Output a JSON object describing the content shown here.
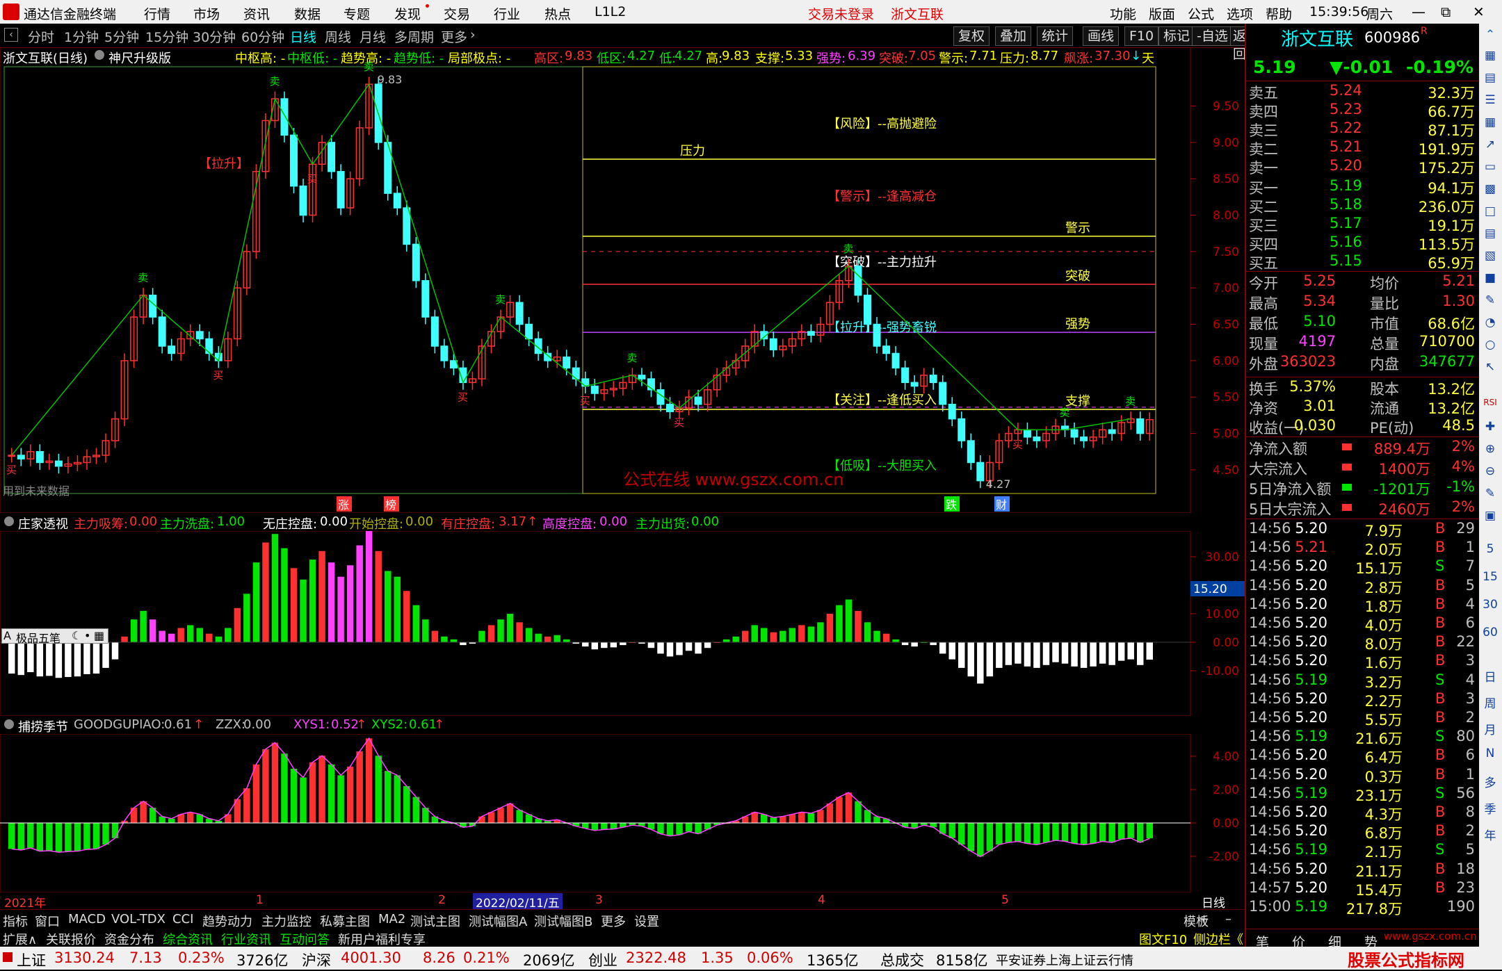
{
  "menu": {
    "app_title": "通达信金融终端",
    "items": [
      "行情",
      "市场",
      "资讯",
      "数据",
      "专题",
      "发现",
      "交易",
      "行业",
      "热点",
      "L1L2"
    ],
    "login": "交易未登录",
    "stock_name_top": "浙文互联",
    "right": [
      "功能",
      "版面",
      "公式",
      "选项",
      "帮助"
    ],
    "time": "15:39:56",
    "weekday": "周六"
  },
  "period": {
    "items": [
      "分时",
      "1分钟",
      "5分钟",
      "15分钟",
      "30分钟",
      "60分钟",
      "日线",
      "周线",
      "月线",
      "多周期",
      "更多"
    ],
    "active": "日线",
    "tools": [
      "复权",
      "叠加",
      "统计",
      "画线",
      "F10",
      "标记",
      "-自选",
      "返回"
    ]
  },
  "main_header": {
    "title": "浙文互联(日线)",
    "formula": "神尺升级版",
    "f1": "中枢高: -",
    "f2": "中枢低: -",
    "f3": "趋势高: -",
    "f4": "趋势低: -",
    "f5": "局部极点: -",
    "hi_zone_label": "高区:",
    "hi_zone": "9.83",
    "lo_zone_label": "低区:",
    "lo_zone": "4.27",
    "low_label": "低:",
    "low": "4.27",
    "high_label": "高:",
    "high": "9.83",
    "support_label": "支撑:",
    "support": "5.33",
    "strong_label": "强势:",
    "strong": "6.39",
    "break_label": "突破:",
    "break": "7.05",
    "warn_label": "警示:",
    "warn": "7.71",
    "press_label": "压力:",
    "press": "8.77",
    "surge_label": "飙涨:",
    "surge": "37.30",
    "tail": "天"
  },
  "chart_data": {
    "type": "candlestick",
    "y_ticks": [
      "9.50",
      "9.00",
      "8.50",
      "8.00",
      "7.50",
      "7.00",
      "6.50",
      "6.00",
      "5.50",
      "5.00",
      "4.50"
    ],
    "ylim": [
      4.27,
      9.83
    ],
    "high_mark": "9.83",
    "low_mark": "4.27",
    "levels": [
      {
        "name": "压力",
        "value": 8.77,
        "color": "#ffff40"
      },
      {
        "name": "警示",
        "value": 7.71,
        "color": "#ffff40"
      },
      {
        "name": "突破",
        "value": 7.05,
        "color": "#ff3030"
      },
      {
        "name": "强势",
        "value": 6.39,
        "color": "#c040ff"
      },
      {
        "name": "支撑",
        "value": 5.33,
        "color": "#ffff40"
      }
    ],
    "annotations": [
      "【风险】--高抛避险",
      "【警示】--逢高减仓",
      "【突破】--主力拉升",
      "【拉升】--强势畜锐",
      "【关注】--逢低买入",
      "【低吸】--大胆买入",
      "【拉升】"
    ],
    "buy_label": "买",
    "sell_label": "卖",
    "watermark": "公式在线 www.gszx.com.cn",
    "future_note": "用到未来数据",
    "bottom_marks": [
      "涨",
      "榜",
      "跌",
      "财"
    ],
    "closes": [
      4.7,
      4.65,
      4.75,
      4.6,
      4.62,
      4.55,
      4.58,
      4.6,
      4.68,
      4.7,
      4.9,
      5.2,
      6.0,
      6.6,
      6.9,
      6.6,
      6.2,
      6.1,
      6.3,
      6.4,
      6.3,
      6.1,
      6.0,
      6.3,
      7.0,
      7.5,
      8.6,
      9.3,
      9.6,
      9.1,
      8.4,
      8.0,
      8.7,
      9.0,
      8.6,
      8.1,
      8.5,
      9.2,
      9.8,
      9.0,
      8.3,
      8.1,
      7.6,
      7.1,
      6.6,
      6.2,
      6.0,
      5.9,
      5.7,
      5.75,
      6.2,
      6.4,
      6.6,
      6.8,
      6.5,
      6.3,
      6.1,
      6.0,
      6.05,
      5.9,
      5.75,
      5.65,
      5.55,
      5.6,
      5.62,
      5.7,
      5.8,
      5.75,
      5.6,
      5.4,
      5.3,
      5.35,
      5.5,
      5.4,
      5.6,
      5.8,
      5.9,
      6.0,
      6.2,
      6.4,
      6.3,
      6.15,
      6.2,
      6.3,
      6.4,
      6.35,
      6.5,
      6.8,
      7.1,
      7.3,
      6.9,
      6.5,
      6.2,
      6.1,
      5.9,
      5.7,
      5.65,
      5.8,
      5.7,
      5.4,
      5.2,
      4.9,
      4.6,
      4.35,
      4.6,
      4.9,
      5.0,
      5.05,
      4.95,
      4.9,
      5.0,
      5.1,
      5.05,
      4.95,
      4.9,
      4.95,
      5.05,
      5.0,
      5.15,
      5.2,
      5.0,
      5.19
    ]
  },
  "zhuangjia": {
    "title": "庄家透视",
    "items": [
      {
        "label": "主力吸筹:",
        "value": "0.00",
        "color": "#ff3030"
      },
      {
        "label": "主力洗盘:",
        "value": "1.00",
        "color": "#00e600"
      },
      {
        "label": "无庄控盘:",
        "value": "0.00",
        "color": "#ffffff"
      },
      {
        "label": "开始控盘:",
        "value": "0.00",
        "color": "#b0b000"
      },
      {
        "label": "有庄控盘:",
        "value": "3.17",
        "color": "#ff3030"
      },
      {
        "label": "高度控盘:",
        "value": "0.00",
        "color": "#ff40ff"
      },
      {
        "label": "主力出货:",
        "value": "0.00",
        "color": "#00e600"
      }
    ],
    "y_ticks": [
      "30.00",
      "20.00",
      "10.00",
      "0.00",
      "-10.00"
    ],
    "current": "15.20",
    "brush_label": "极品五笔"
  },
  "buzhuo": {
    "title": "捕捞季节",
    "items": [
      {
        "label": "GOODGUPIAO:",
        "value": "0.61",
        "color": "#c0c0c0"
      },
      {
        "label": "ZZX:",
        "value": "0.00",
        "color": "#c0c0c0"
      },
      {
        "label": "XYS1:",
        "value": "0.52",
        "color": "#ff40ff"
      },
      {
        "label": "XYS2:",
        "value": "0.61",
        "color": "#00e600"
      }
    ],
    "y_ticks": [
      "4.00",
      "2.00",
      "0.00",
      "-2.00"
    ]
  },
  "time_axis": {
    "year": "2021年",
    "m1": "1",
    "m2": "2",
    "date": "2022/02/11/五",
    "m3": "3",
    "m4": "4",
    "m5": "5",
    "period": "日线"
  },
  "tabs1": [
    "指标",
    "窗口",
    "MACD",
    "VOL-TDX",
    "CCI",
    "趋势动力",
    "主力监控",
    "私募主图",
    "MA2",
    "测试主图",
    "测试幅图A",
    "测试幅图B",
    "更多",
    "设置"
  ],
  "tabs1_right": "模板",
  "tabs2": [
    "扩展∧",
    "关联报价",
    "资金分布",
    "综合资讯",
    "行业资讯",
    "互动问答",
    "新用户福利专享"
  ],
  "tabs2_right": [
    "图文F10",
    "侧边栏《"
  ],
  "quote": {
    "name": "浙文互联",
    "code": "600986",
    "flag": "R",
    "price": "5.19",
    "change": "▼-0.01",
    "pct": "-0.19%",
    "asks": [
      {
        "label": "卖五",
        "price": "5.24",
        "vol": "32.3万"
      },
      {
        "label": "卖四",
        "price": "5.23",
        "vol": "66.7万"
      },
      {
        "label": "卖三",
        "price": "5.22",
        "vol": "87.1万"
      },
      {
        "label": "卖二",
        "price": "5.21",
        "vol": "191.9万"
      },
      {
        "label": "卖一",
        "price": "5.20",
        "vol": "175.2万"
      }
    ],
    "bids": [
      {
        "label": "买一",
        "price": "5.19",
        "vol": "94.1万"
      },
      {
        "label": "买二",
        "price": "5.18",
        "vol": "236.0万"
      },
      {
        "label": "买三",
        "price": "5.17",
        "vol": "19.1万"
      },
      {
        "label": "买四",
        "price": "5.16",
        "vol": "113.5万"
      },
      {
        "label": "买五",
        "price": "5.15",
        "vol": "65.9万"
      }
    ],
    "stats": [
      [
        "今开",
        "5.25",
        "均价",
        "5.21"
      ],
      [
        "最高",
        "5.34",
        "量比",
        "1.30"
      ],
      [
        "最低",
        "5.10",
        "市值",
        "68.6亿"
      ],
      [
        "现量",
        "4197",
        "总量",
        "710700"
      ],
      [
        "外盘",
        "363023",
        "内盘",
        "347677"
      ]
    ],
    "stats2": [
      [
        "换手",
        "5.37%",
        "股本",
        "13.2亿"
      ],
      [
        "净资",
        "3.01",
        "流通",
        "13.2亿"
      ],
      [
        "收益(一)",
        "0.030",
        "PE(动)",
        "48.5"
      ]
    ],
    "flows": [
      {
        "label": "净流入额",
        "value": "889.4万",
        "pct": "2%",
        "dir": "up"
      },
      {
        "label": "大宗流入",
        "value": "1400万",
        "pct": "4%",
        "dir": "up"
      },
      {
        "label": "5日净流入额",
        "value": "-1201万",
        "pct": "-1%",
        "dir": "down"
      },
      {
        "label": "5日大宗流入",
        "value": "2460万",
        "pct": "2%",
        "dir": "up"
      }
    ],
    "ticks": [
      [
        "14:56",
        "5.20",
        "7.9万",
        "B",
        "29"
      ],
      [
        "14:56",
        "5.21",
        "2.0万",
        "B",
        "1"
      ],
      [
        "14:56",
        "5.20",
        "15.1万",
        "S",
        "7"
      ],
      [
        "14:56",
        "5.20",
        "2.8万",
        "B",
        "5"
      ],
      [
        "14:56",
        "5.20",
        "1.8万",
        "B",
        "4"
      ],
      [
        "14:56",
        "5.20",
        "4.0万",
        "B",
        "6"
      ],
      [
        "14:56",
        "5.20",
        "8.0万",
        "B",
        "22"
      ],
      [
        "14:56",
        "5.20",
        "1.6万",
        "B",
        "3"
      ],
      [
        "14:56",
        "5.19",
        "3.2万",
        "S",
        "4"
      ],
      [
        "14:56",
        "5.20",
        "2.2万",
        "B",
        "3"
      ],
      [
        "14:56",
        "5.20",
        "5.5万",
        "B",
        "2"
      ],
      [
        "14:56",
        "5.19",
        "21.6万",
        "S",
        "80"
      ],
      [
        "14:56",
        "5.20",
        "6.4万",
        "B",
        "6"
      ],
      [
        "14:56",
        "5.20",
        "0.3万",
        "B",
        "1"
      ],
      [
        "14:56",
        "5.19",
        "23.1万",
        "S",
        "56"
      ],
      [
        "14:56",
        "5.20",
        "4.3万",
        "B",
        "8"
      ],
      [
        "14:56",
        "5.20",
        "6.8万",
        "B",
        "2"
      ],
      [
        "14:56",
        "5.19",
        "2.1万",
        "S",
        "5"
      ],
      [
        "14:56",
        "5.20",
        "21.1万",
        "B",
        "18"
      ],
      [
        "14:57",
        "5.20",
        "15.4万",
        "B",
        "23"
      ],
      [
        "15:00",
        "5.19",
        "217.8万",
        "",
        "190"
      ]
    ],
    "bottom_tabs": [
      "笔",
      "价",
      "细",
      "势"
    ]
  },
  "right_tools": [
    "日",
    "周",
    "月",
    "N",
    "多",
    "季",
    "年",
    "5",
    "15",
    "30",
    "60",
    "RSI"
  ],
  "status": {
    "idx1_name": "上证",
    "idx1_val": "3130.24",
    "idx1_chg": "7.13",
    "idx1_pct": "0.23%",
    "idx1_amt": "3726亿",
    "idx2_name": "沪深",
    "idx2_val": "4001.30",
    "idx2_chg": "8.26",
    "idx2_pct": "0.21%",
    "idx2_amt": "2069亿",
    "idx3_name": "创业",
    "idx3_val": "2322.48",
    "idx3_chg": "1.35",
    "idx3_pct": "0.06%",
    "idx3_amt": "1365亿",
    "total_label": "总成交",
    "total": "8158亿",
    "source": "平安证券上海上证云行情",
    "logo1": "股票公式指标网",
    "logo2": "www.gszx.com.cn"
  }
}
